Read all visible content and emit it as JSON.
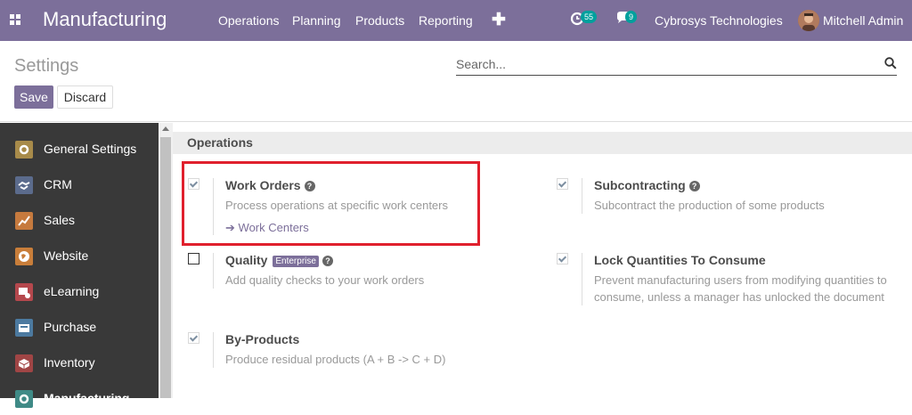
{
  "navbar": {
    "app_title": "Manufacturing",
    "menu": [
      "Operations",
      "Planning",
      "Products",
      "Reporting"
    ],
    "activity_count": "55",
    "message_count": "9",
    "company": "Cybrosys Technologies",
    "user": "Mitchell Admin"
  },
  "control_panel": {
    "title": "Settings",
    "search_placeholder": "Search...",
    "save_label": "Save",
    "discard_label": "Discard"
  },
  "sidebar": {
    "items": [
      {
        "label": "General Settings",
        "icon": "gear-icon",
        "color": "#a88b4a"
      },
      {
        "label": "CRM",
        "icon": "handshake-icon",
        "color": "#5b6b8c"
      },
      {
        "label": "Sales",
        "icon": "chart-icon",
        "color": "#c67a3e"
      },
      {
        "label": "Website",
        "icon": "globe-icon",
        "color": "#c97e3a"
      },
      {
        "label": "eLearning",
        "icon": "elearning-icon",
        "color": "#b5484d"
      },
      {
        "label": "Purchase",
        "icon": "purchase-icon",
        "color": "#4c7aa0"
      },
      {
        "label": "Inventory",
        "icon": "box-icon",
        "color": "#a04545"
      },
      {
        "label": "Manufacturing",
        "icon": "manufacturing-icon",
        "color": "#3f8a86"
      }
    ]
  },
  "section": {
    "title": "Operations",
    "settings": [
      {
        "name": "Work Orders",
        "description": "Process operations at specific work centers",
        "link": "Work Centers",
        "checked": true
      },
      {
        "name": "Subcontracting",
        "description": "Subcontract the production of some products",
        "checked": true
      },
      {
        "name": "Quality",
        "badge": "Enterprise",
        "description": "Add quality checks to your work orders",
        "checked": false
      },
      {
        "name": "Lock Quantities To Consume",
        "description": "Prevent manufacturing users from modifying quantities to",
        "description2": "consume, unless a manager has unlocked the document",
        "checked": true
      },
      {
        "name": "By-Products",
        "description": "Produce residual products (A + B -> C + D)",
        "checked": true
      }
    ]
  },
  "colors": {
    "primary": "#7c6f9a",
    "sidebar_bg": "#393939",
    "highlight": "#e0202d"
  }
}
